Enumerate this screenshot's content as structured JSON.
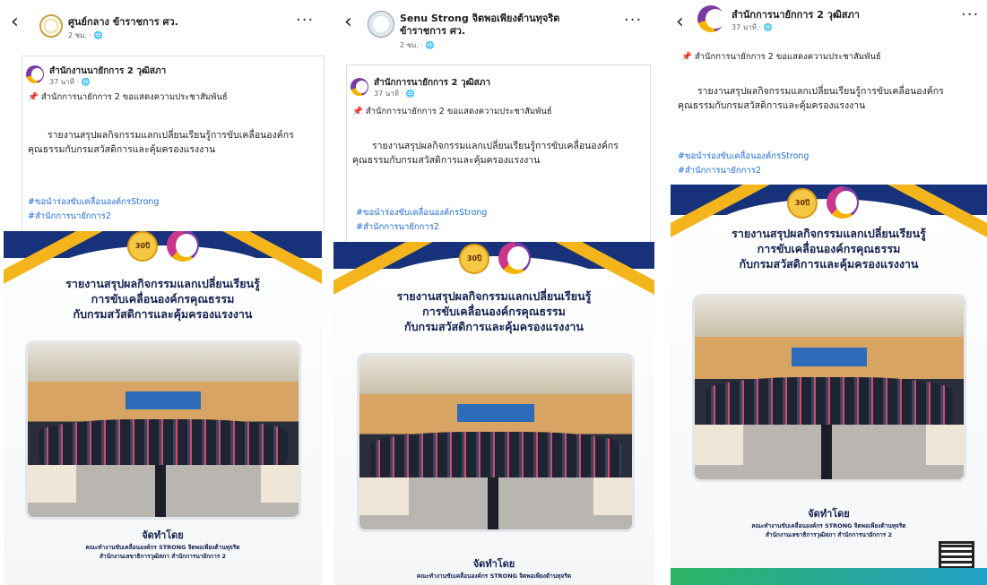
{
  "panels": [
    {
      "header": {
        "title": "ศูนย์กลาง ข้าราชการ ศว.",
        "subtitle": "2 ชม. · 🌐",
        "more": "···"
      },
      "post": {
        "author": "สำนักงานนายักการ 2 วุฒิสภา",
        "time": "37 นาที · 🌐",
        "pinned_line": "สำนักการนายักการ 2 ขอแสดงความประชาสัมพันธ์",
        "body": "รายงานสรุปผลกิจกรรมแลกเปลี่ยนเรียนรู้การขับเคลื่อนองค์กรคุณธรรมกับกรมสวัสดิการและคุ้มครองแรงงาน",
        "tags": [
          "#ขอนำร่องขับเคลื่อนองค์กรStrong",
          "#สำนักการนายักการ2"
        ]
      },
      "flyer": {
        "title_lines": [
          "รายงานสรุปผลกิจกรรมแลกเปลี่ยนเรียนรู้",
          "การขับเคลื่อนองค์กรคุณธรรม",
          "กับกรมสวัสดิการและคุ้มครองแรงงาน"
        ],
        "org_title": "จัดทำโดย",
        "org_lines": [
          "คณะทำงานขับเคลื่อนองค์กร STRONG จิตพอเพียงต้านทุจริต",
          "สำนักงานเลขาธิการวุฒิสภา สำนักการนายักการ 2"
        ]
      }
    },
    {
      "header": {
        "title": "Senu Strong จิตพอเพียงต้านทุจริต ข้าราชการ ศว.",
        "subtitle": "2 ชม. · 🌐",
        "more": "···"
      },
      "post": {
        "author": "สำนักการนายักการ 2 วุฒิสภา",
        "time": "37 นาที · 🌐",
        "pinned_line": "สำนักการนายักการ 2 ขอแสดงความประชาสัมพันธ์",
        "body": "รายงานสรุปผลกิจกรรมแลกเปลี่ยนเรียนรู้การขับเคลื่อนองค์กรคุณธรรมกับกรมสวัสดิการและคุ้มครองแรงงาน",
        "tags": [
          "#ขอนำร่องขับเคลื่อนองค์กรStrong",
          "#สำนักการนายักการ2"
        ]
      },
      "flyer": {
        "title_lines": [
          "รายงานสรุปผลกิจกรรมแลกเปลี่ยนเรียนรู้",
          "การขับเคลื่อนองค์กรคุณธรรม",
          "กับกรมสวัสดิการและคุ้มครองแรงงาน"
        ],
        "org_title": "จัดทำโดย",
        "org_lines": [
          "คณะทำงานขับเคลื่อนองค์กร STRONG จิตพอเพียงต้านทุจริต"
        ]
      }
    },
    {
      "header": {
        "title": "สำนักการนายักการ 2 วุฒิสภา",
        "subtitle": "37 นาที · 🌐",
        "more": "···"
      },
      "post": {
        "pinned_line": "สำนักการนายักการ 2 ขอแสดงความประชาสัมพันธ์",
        "body": "รายงานสรุปผลกิจกรรมแลกเปลี่ยนเรียนรู้การขับเคลื่อนองค์กรคุณธรรมกับกรมสวัสดิการและคุ้มครองแรงงาน",
        "tags": [
          "#ขอนำร่องขับเคลื่อนองค์กรStrong",
          "#สำนักการนายักการ2"
        ]
      },
      "flyer": {
        "title_lines": [
          "รายงานสรุปผลกิจกรรมแลกเปลี่ยนเรียนรู้",
          "การขับเคลื่อนองค์กรคุณธรรม",
          "กับกรมสวัสดิการและคุ้มครองแรงงาน"
        ],
        "org_title": "จัดทำโดย",
        "org_lines": [
          "คณะทำงานขับเคลื่อนองค์กร STRONG จิตพอเพียงต้านทุจริต",
          "สำนักงานเลขาธิการวุฒิสภา สำนักการนายักการ 2"
        ]
      }
    }
  ],
  "back_glyph": "‹",
  "pin_glyph": "📌",
  "logo_badge": "30ปี"
}
